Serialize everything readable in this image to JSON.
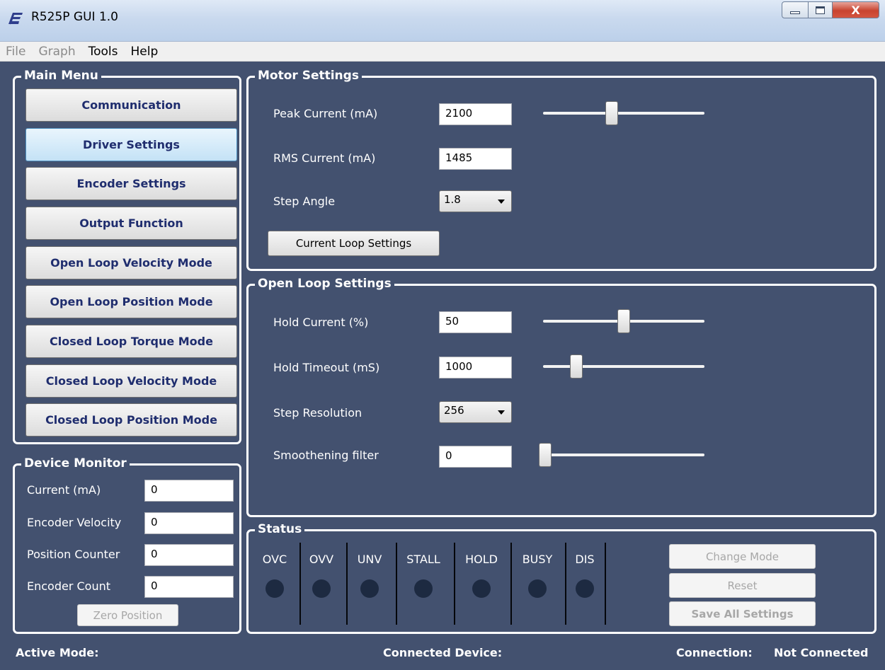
{
  "window": {
    "title": "R525P GUI 1.0",
    "icon": "app-logo-icon",
    "controls": {
      "minimize": "minimize-icon",
      "maximize": "maximize-icon",
      "close_label": "X"
    }
  },
  "menubar": {
    "items": [
      "File",
      "Graph",
      "Tools",
      "Help"
    ]
  },
  "main_menu": {
    "title": "Main Menu",
    "buttons": [
      "Communication",
      "Driver Settings",
      "Encoder Settings",
      "Output Function",
      "Open Loop Velocity Mode",
      "Open Loop Position Mode",
      "Closed Loop Torque Mode",
      "Closed Loop Velocity Mode",
      "Closed Loop Position Mode"
    ],
    "active": "Driver Settings"
  },
  "device_monitor": {
    "title": "Device Monitor",
    "rows": [
      {
        "label": "Current (mA)",
        "value": "0"
      },
      {
        "label": "Encoder Velocity",
        "value": "0"
      },
      {
        "label": "Position Counter",
        "value": "0"
      },
      {
        "label": "Encoder Count",
        "value": "0"
      }
    ],
    "zero_button": "Zero Position"
  },
  "motor_settings": {
    "title": "Motor Settings",
    "peak_current": {
      "label": "Peak Current (mA)",
      "value": "2100",
      "slider_fraction": 0.42
    },
    "rms_current": {
      "label": "RMS Current (mA)",
      "value": "1485"
    },
    "step_angle": {
      "label": "Step Angle",
      "value": "1.8"
    },
    "current_loop_button": "Current Loop Settings"
  },
  "open_loop_settings": {
    "title": "Open Loop Settings",
    "hold_current": {
      "label": "Hold Current (%)",
      "value": "50",
      "slider_fraction": 0.5
    },
    "hold_timeout": {
      "label": "Hold Timeout (mS)",
      "value": "1000",
      "slider_fraction": 0.18
    },
    "step_resolution": {
      "label": "Step Resolution",
      "value": "256"
    },
    "smoothening_filter": {
      "label": "Smoothening filter",
      "value": "0",
      "slider_fraction": 0.0
    }
  },
  "status": {
    "title": "Status",
    "indicators": [
      "OVC",
      "OVV",
      "UNV",
      "STALL",
      "HOLD",
      "BUSY",
      "DIS"
    ],
    "led_color": "#1d2a41",
    "buttons": {
      "change_mode": "Change Mode",
      "reset": "Reset",
      "save_all": "Save All Settings"
    }
  },
  "footer": {
    "active_mode_label": "Active Mode:",
    "active_mode_value": "",
    "connected_device_label": "Connected Device:",
    "connected_device_value": "",
    "connection_label": "Connection:",
    "connection_value": "Not Connected"
  },
  "colors": {
    "background": "#43516f",
    "button_text": "#1f2d6e"
  }
}
